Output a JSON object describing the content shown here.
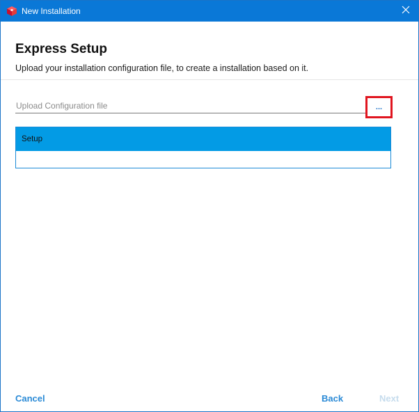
{
  "window": {
    "title": "New Installation",
    "app_icon": "red-box-icon",
    "close_icon": "close-icon"
  },
  "header": {
    "title": "Express Setup",
    "subtitle": "Upload your installation configuration file, to create a installation based on it."
  },
  "upload": {
    "placeholder": "Upload Configuration file",
    "value": "",
    "browse_label": "..."
  },
  "setup_list": {
    "header": "Setup",
    "items": []
  },
  "footer": {
    "cancel_label": "Cancel",
    "back_label": "Back",
    "next_label": "Next",
    "next_enabled": false
  },
  "colors": {
    "titlebar": "#0a78d7",
    "accent": "#2a8ad6",
    "list_header": "#039be5",
    "highlight_border": "#e0151f",
    "disabled_text": "#c6dced"
  }
}
